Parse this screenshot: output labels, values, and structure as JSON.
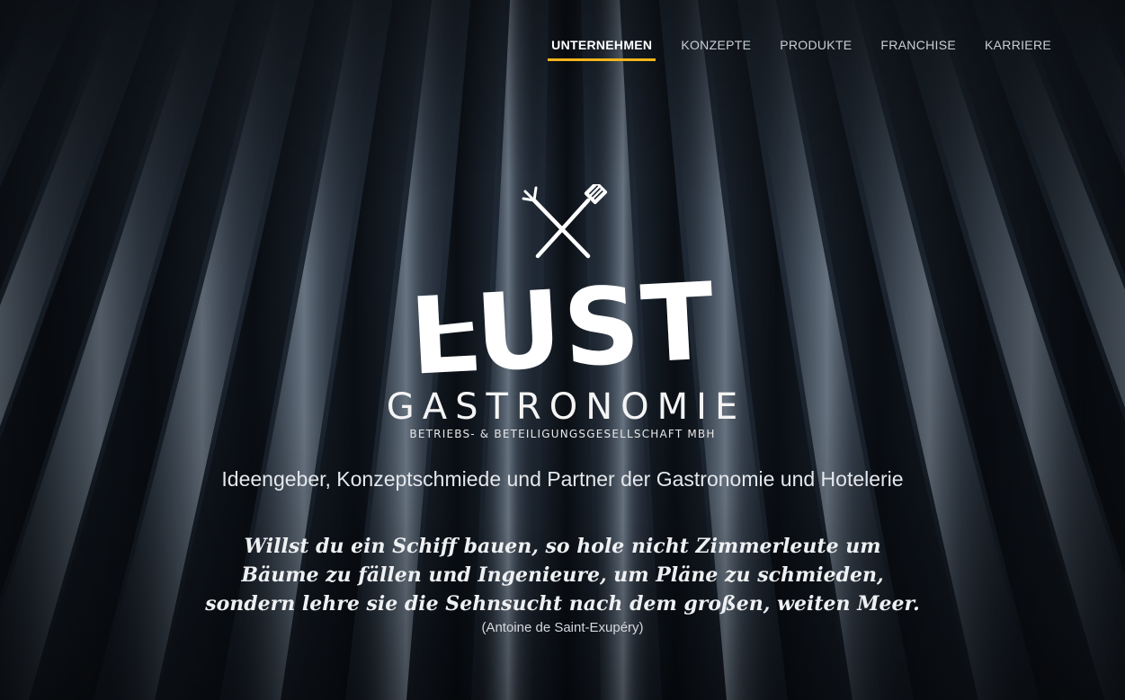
{
  "nav": {
    "items": [
      {
        "label": "UNTERNEHMEN",
        "active": true
      },
      {
        "label": "KONZEPTE",
        "active": false
      },
      {
        "label": "PRODUKTE",
        "active": false
      },
      {
        "label": "FRANCHISE",
        "active": false
      },
      {
        "label": "KARRIERE",
        "active": false
      }
    ],
    "active_underline_color": "#f2b51b"
  },
  "logo": {
    "icon": "crossed-fork-spatula-icon",
    "wordmark": "LUST",
    "name": "GASTRONOMIE",
    "subline": "BETRIEBS- & BETEILIGUNGSGESELLSCHAFT MBH"
  },
  "tagline": "Ideengeber, Konzeptschmiede und Partner der Gastronomie und Hotelerie",
  "quote": {
    "lines": [
      "Willst du ein Schiff bauen, so hole nicht Zimmerleute um",
      "Bäume zu fällen und Ingenieure, um Pläne zu schmieden,",
      "sondern lehre sie die Sehnsucht nach dem großen, weiten Meer."
    ],
    "author": "(Antoine de Saint-Exupéry)"
  },
  "colors": {
    "background": "#1a222c",
    "text": "#ffffff",
    "accent": "#f2b51b"
  }
}
